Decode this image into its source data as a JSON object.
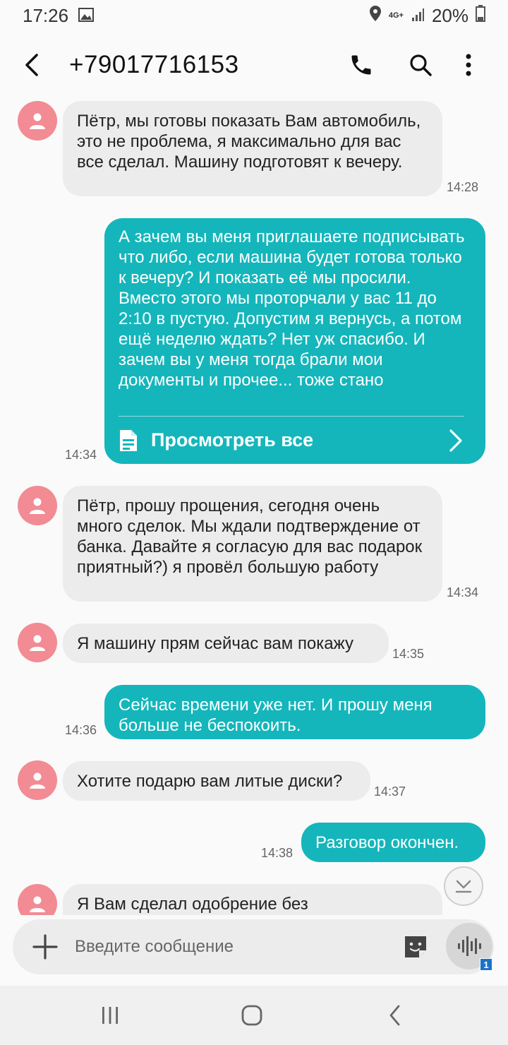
{
  "status_bar": {
    "time": "17:26",
    "network_top": "4G+",
    "battery": "20%"
  },
  "header": {
    "contact": "+79017716153"
  },
  "messages": [
    {
      "dir": "in",
      "text": "Пётр, мы готовы показать Вам автомобиль, это не проблема, я максимально для вас все сделал. Машину подготовят к вечеру.",
      "time": "14:28"
    },
    {
      "dir": "out",
      "text": "А зачем вы меня приглашаете подписывать что либо, если машина будет готова только к вечеру? И показать её мы просили. Вместо этого мы проторчали у вас 11 до 2:10 в пустую. Допустим я вернусь, а потом ещё неделю ждать? Нет уж спасибо. И зачем вы у меня тогда брали мои документы и прочее... тоже стано",
      "time": "14:34",
      "view_all": "Просмотреть все"
    },
    {
      "dir": "in",
      "text": "Пётр, прошу прощения, сегодня очень много сделок. Мы ждали подтверждение от банка. Давайте я согласую для вас подарок приятный?) я провёл большую работу",
      "time": "14:34"
    },
    {
      "dir": "in",
      "text": "Я машину прям сейчас вам покажу",
      "time": "14:35"
    },
    {
      "dir": "out",
      "text": "Сейчас времени уже нет. И прошу меня больше не беспокоить.",
      "time": "14:36"
    },
    {
      "dir": "in",
      "text": "Хотите подарю вам литые диски?",
      "time": "14:37"
    },
    {
      "dir": "out",
      "text": "Разговор окончен.",
      "time": "14:38"
    },
    {
      "dir": "in",
      "text": "Я Вам сделал одобрение без",
      "time": ""
    }
  ],
  "input": {
    "placeholder": "Введите сообщение",
    "mic_badge": "1"
  },
  "colors": {
    "outgoing": "#14b6bb",
    "incoming": "#ececec",
    "avatar": "#f28b93"
  }
}
